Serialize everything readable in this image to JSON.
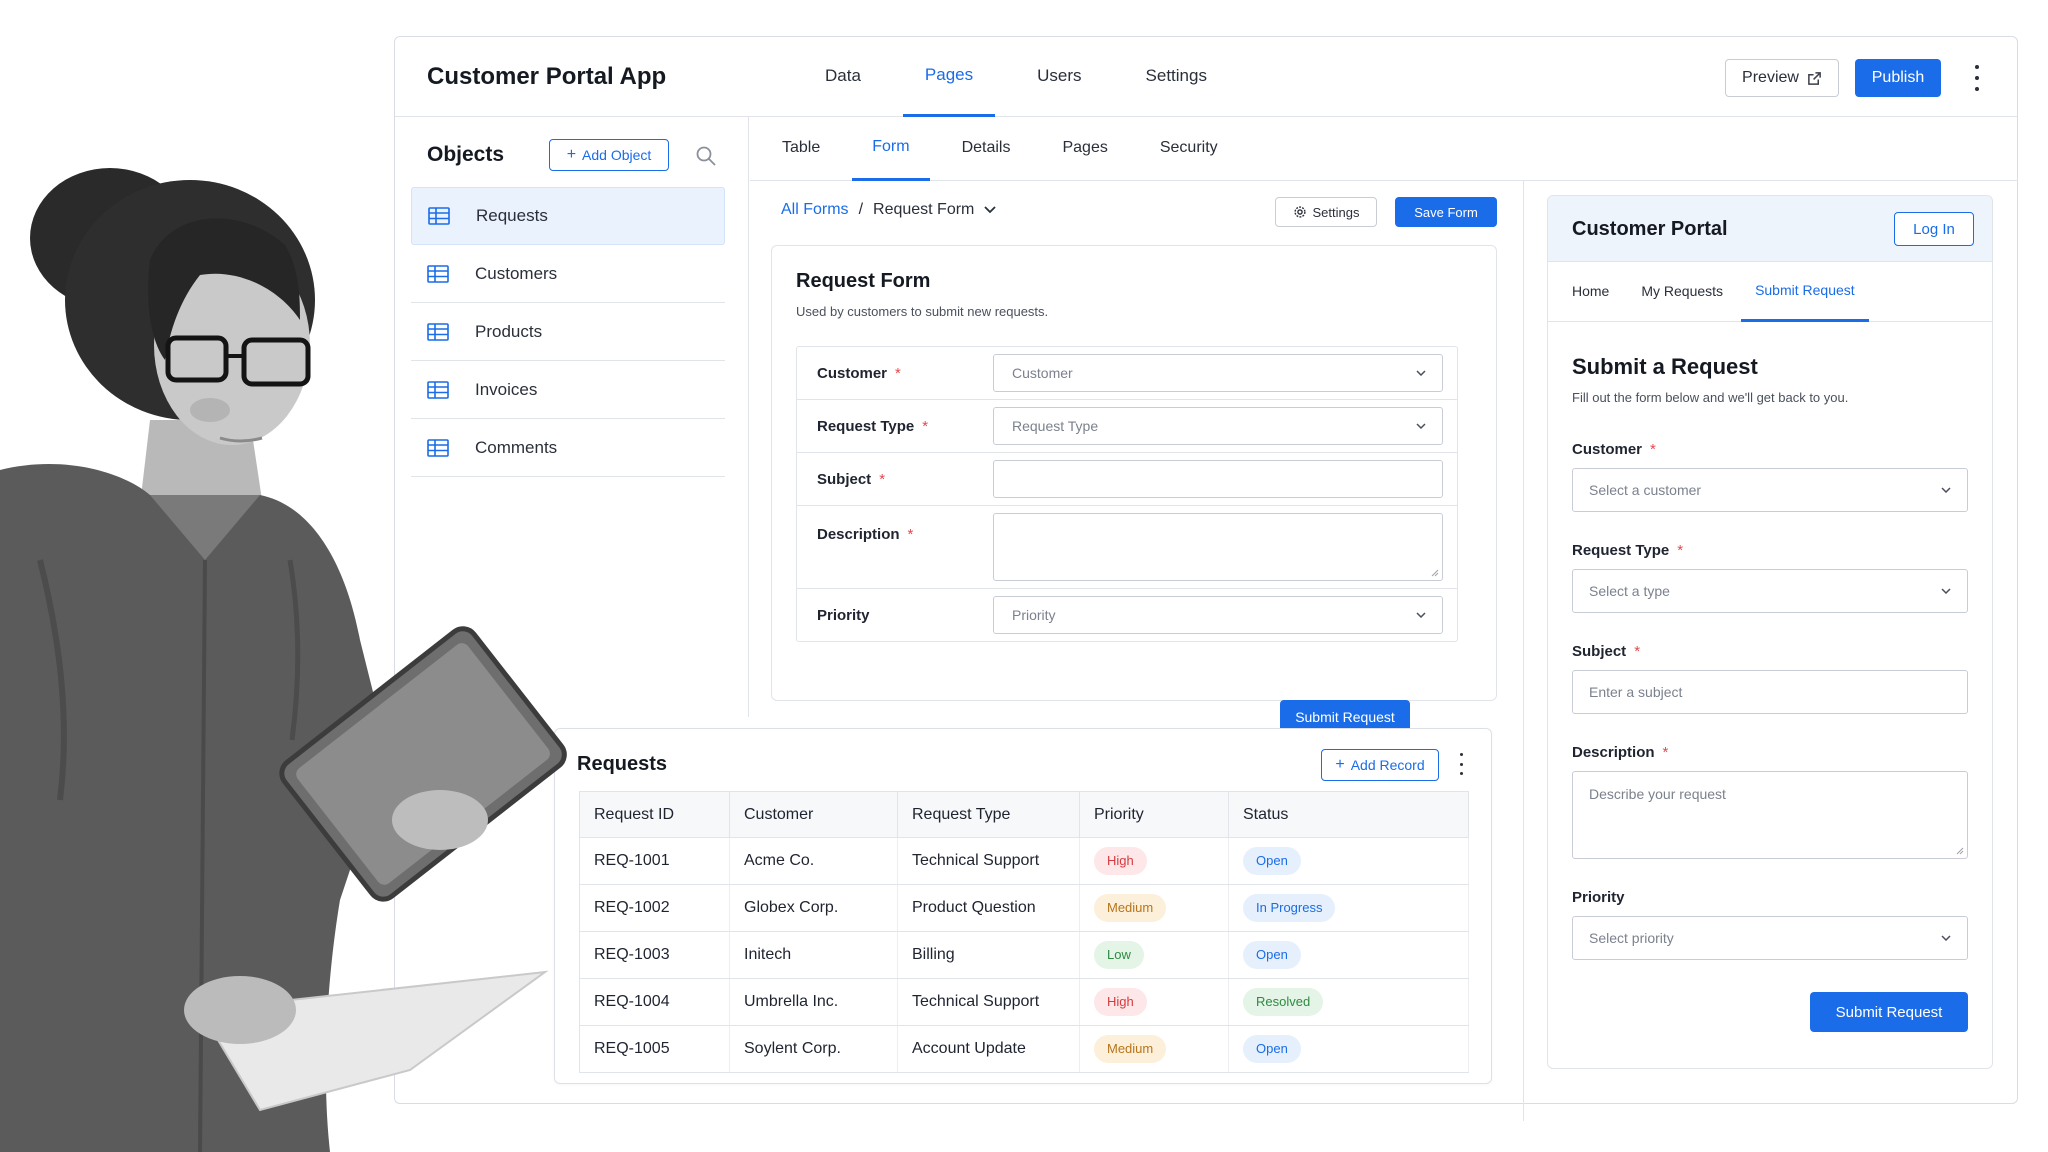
{
  "app": {
    "title": "Customer Portal App",
    "nav": [
      "Data",
      "Pages",
      "Users",
      "Settings"
    ],
    "active_nav": "Pages",
    "preview_label": "Preview",
    "publish_label": "Publish",
    "accent_color": "#1a6ce8"
  },
  "sidebar": {
    "title": "Objects",
    "add_label": "Add Object",
    "items": [
      {
        "label": "Requests",
        "active": true
      },
      {
        "label": "Customers"
      },
      {
        "label": "Products"
      },
      {
        "label": "Invoices"
      },
      {
        "label": "Comments"
      }
    ]
  },
  "subtabs": [
    "Table",
    "Form",
    "Details",
    "Pages",
    "Security"
  ],
  "active_subtab": "Form",
  "breadcrumb": {
    "root": "All Forms",
    "separator": "/",
    "current": "Request Form"
  },
  "toolbar": {
    "settings_label": "Settings",
    "save_label": "Save Form"
  },
  "form": {
    "title": "Request Form",
    "subtitle": "Used by customers to submit new requests.",
    "required_mark": "*",
    "fields": [
      {
        "label": "Customer",
        "placeholder": "Customer",
        "type": "select"
      },
      {
        "label": "Request Type",
        "placeholder": "Request Type",
        "type": "select"
      },
      {
        "label": "Subject",
        "placeholder": "",
        "type": "text"
      },
      {
        "label": "Description",
        "placeholder": "",
        "type": "textarea"
      },
      {
        "label": "Priority",
        "placeholder": "Priority",
        "type": "select"
      }
    ],
    "submit_label": "Submit Request"
  },
  "portal": {
    "title": "Customer Portal",
    "login_label": "Log In",
    "tabs": [
      "Home",
      "My Requests",
      "Submit Request"
    ],
    "active_tab": "Submit Request",
    "heading": "Submit a Request",
    "subheading": "Fill out the form below and we'll get back to you.",
    "fields": [
      {
        "label": "Customer",
        "placeholder": "Select a customer",
        "required": true
      },
      {
        "label": "Request Type",
        "placeholder": "Select a type",
        "required": true
      },
      {
        "label": "Subject",
        "placeholder": "Enter a subject",
        "required": true
      },
      {
        "label": "Description",
        "placeholder": "Describe your request",
        "required": true
      },
      {
        "label": "Priority",
        "placeholder": "Select priority",
        "required": false
      }
    ],
    "submit_label": "Submit Request"
  },
  "requests": {
    "title": "Requests",
    "add_label": "Add Record",
    "columns": [
      "Request ID",
      "Customer",
      "Request Type",
      "Priority",
      "Status"
    ],
    "rows": [
      {
        "id": "REQ-1001",
        "customer": "Acme Co.",
        "type": "Technical Support",
        "priority": "High",
        "status": "Open"
      },
      {
        "id": "REQ-1002",
        "customer": "Globex Corp.",
        "type": "Product Question",
        "priority": "Medium",
        "status": "In Progress"
      },
      {
        "id": "REQ-1003",
        "customer": "Initech",
        "type": "Billing",
        "priority": "Low",
        "status": "Open"
      },
      {
        "id": "REQ-1004",
        "customer": "Umbrella Inc.",
        "type": "Technical Support",
        "priority": "High",
        "status": "Resolved"
      },
      {
        "id": "REQ-1005",
        "customer": "Soylent Corp.",
        "type": "Account Update",
        "priority": "Medium",
        "status": "Open"
      }
    ]
  }
}
